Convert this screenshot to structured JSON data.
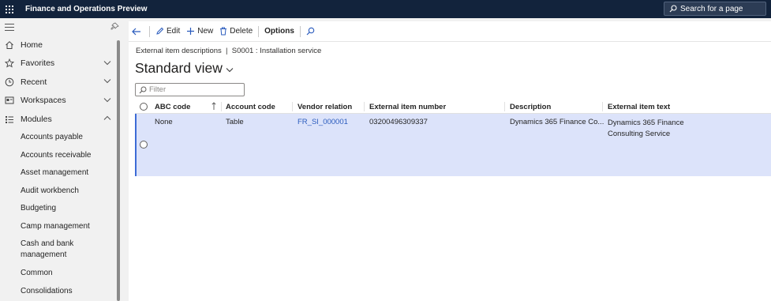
{
  "app": {
    "title": "Finance and Operations Preview",
    "search_placeholder": "Search for a page"
  },
  "nav": {
    "items": [
      {
        "label": "Home",
        "icon": "home-icon"
      },
      {
        "label": "Favorites",
        "icon": "star-icon"
      },
      {
        "label": "Recent",
        "icon": "clock-icon"
      },
      {
        "label": "Workspaces",
        "icon": "workspace-icon"
      },
      {
        "label": "Modules",
        "icon": "list-icon"
      }
    ],
    "modules": [
      "Accounts payable",
      "Accounts receivable",
      "Asset management",
      "Audit workbench",
      "Budgeting",
      "Camp management",
      "Cash and bank management",
      "Common",
      "Consolidations"
    ]
  },
  "actions": {
    "edit": "Edit",
    "new": "New",
    "delete": "Delete",
    "options": "Options"
  },
  "page": {
    "breadcrumb": "External item descriptions  |  S0001 : Installation service",
    "view_title": "Standard view",
    "filter_placeholder": "Filter"
  },
  "grid": {
    "headers": {
      "abc_code": "ABC code",
      "account_code": "Account code",
      "vendor_relation": "Vendor relation",
      "external_item_number": "External item number",
      "description": "Description",
      "external_item_text": "External item text"
    },
    "rows": [
      {
        "abc_code": "None",
        "account_code": "Table",
        "vendor_relation": "FR_SI_000001",
        "external_item_number": "03200496309337",
        "description": "Dynamics 365 Finance Co...",
        "external_item_text": "Dynamics 365 Finance Consulting Service"
      }
    ]
  },
  "colors": {
    "topbar": "#12233c",
    "selected_row": "#dce3fa",
    "accent": "#3c6bd6",
    "link": "#2a5bbd"
  }
}
